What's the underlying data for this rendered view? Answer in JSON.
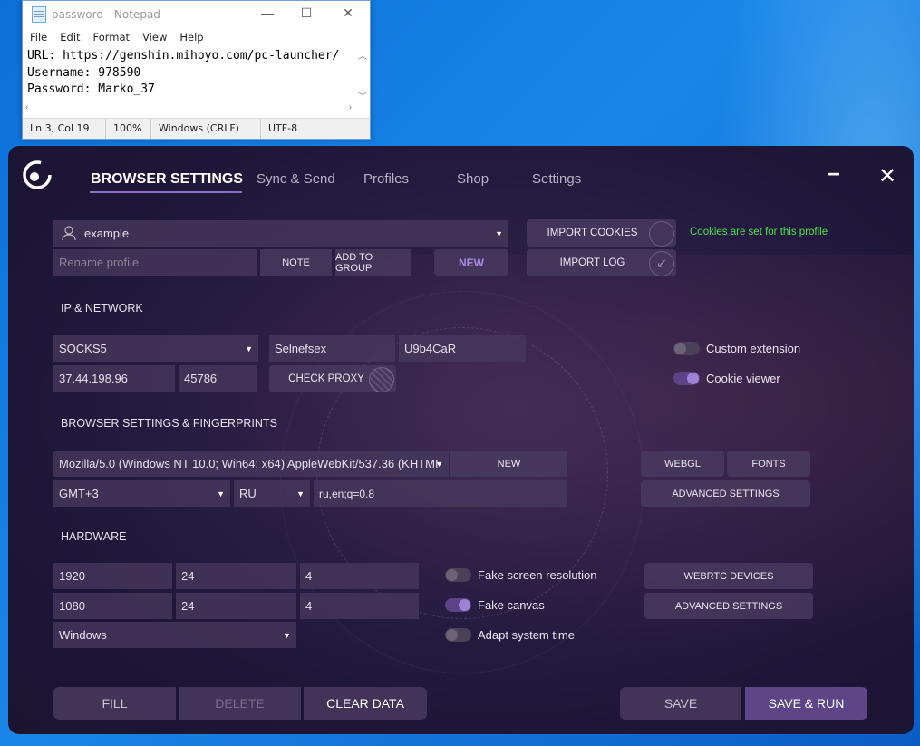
{
  "notepad": {
    "title": "password - Notepad",
    "menu": [
      "File",
      "Edit",
      "Format",
      "View",
      "Help"
    ],
    "lines": [
      "URL: https://genshin.mihoyo.com/pc-launcher/",
      "Username: 978590",
      "Password: Marko_37"
    ],
    "status": {
      "position": "Ln 3, Col 19",
      "zoom": "100%",
      "eol": "Windows (CRLF)",
      "encoding": "UTF-8"
    }
  },
  "app": {
    "tabs": [
      "BROWSER SETTINGS",
      "Sync & Send",
      "Profiles",
      "Shop",
      "Settings"
    ],
    "profile": {
      "name": "example",
      "rename_placeholder": "Rename profile",
      "note_label": "NOTE",
      "add_to_group_label": "ADD TO GROUP",
      "new_label": "NEW",
      "import_cookies_label": "IMPORT COOKIES",
      "import_log_label": "IMPORT LOG",
      "cookies_status": "Cookies are set for this profile"
    },
    "network": {
      "heading": "IP & NETWORK",
      "proxy_type": "SOCKS5",
      "proxy_login": "Selnefsex",
      "proxy_password": "U9b4CaR",
      "ip": "37.44.198.96",
      "port": "45786",
      "check_proxy_label": "CHECK PROXY",
      "custom_extension_label": "Custom extension",
      "custom_extension_on": false,
      "cookie_viewer_label": "Cookie viewer",
      "cookie_viewer_on": true
    },
    "fingerprints": {
      "heading": "BROWSER SETTINGS & FINGERPRINTS",
      "user_agent": "Mozilla/5.0 (Windows NT 10.0; Win64; x64) AppleWebKit/537.36 (KHTMI",
      "new_label": "NEW",
      "webgl_label": "WEBGL",
      "fonts_label": "FONTS",
      "advanced_label": "ADVANCED SETTINGS",
      "timezone": "GMT+3",
      "locale": "RU",
      "accept_language": "ru,en;q=0.8"
    },
    "hardware": {
      "heading": "HARDWARE",
      "width": "1920",
      "height": "1080",
      "col2_row1": "24",
      "col2_row2": "24",
      "col3_row1": "4",
      "col3_row2": "4",
      "os": "Windows",
      "fake_resolution_label": "Fake screen resolution",
      "fake_resolution_on": false,
      "fake_canvas_label": "Fake canvas",
      "fake_canvas_on": true,
      "adapt_time_label": "Adapt system time",
      "adapt_time_on": false,
      "webrtc_label": "WEBRTC DEVICES",
      "advanced_label": "ADVANCED SETTINGS"
    },
    "footer": {
      "fill_label": "FILL",
      "delete_label": "DELETE",
      "clear_label": "CLEAR DATA",
      "save_label": "SAVE",
      "save_run_label": "SAVE & RUN"
    }
  }
}
